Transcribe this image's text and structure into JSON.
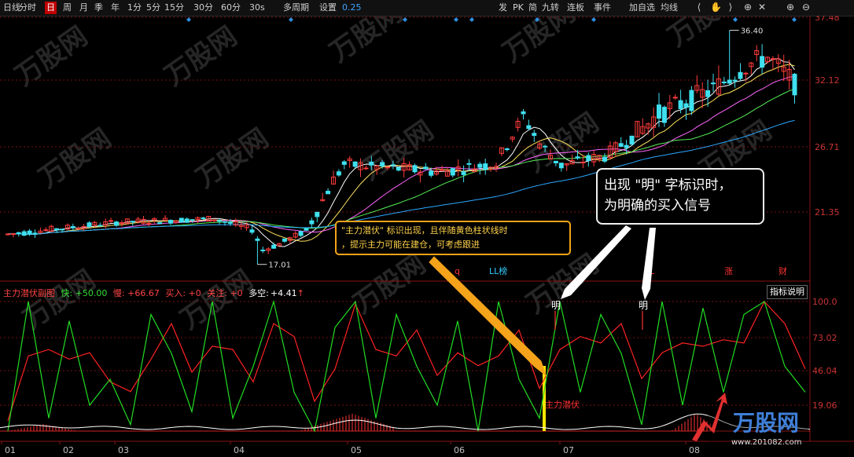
{
  "toolbar": {
    "left_buttons": [
      "日线",
      "分时",
      "日",
      "周",
      "月",
      "季",
      "年",
      "1分",
      "5分",
      "15分",
      "30分",
      "60分",
      "30s",
      "多周期",
      "设置"
    ],
    "selected": "日",
    "period_value": "0.25",
    "right_buttons": [
      "发",
      "PK",
      "简",
      "九转",
      "连板",
      "事件",
      "加自选",
      "均线"
    ],
    "icons": [
      "back-icon",
      "hand-icon",
      "forward-icon",
      "zoom-in-icon",
      "crosshair-icon",
      "zoom-plus-icon",
      "collapse-icon"
    ]
  },
  "price_axis": {
    "labels": [
      "37.48",
      "32.12",
      "26.71",
      "21.35"
    ]
  },
  "indicator_axis": {
    "labels": [
      "100.0",
      "73.02",
      "46.04",
      "19.06"
    ]
  },
  "x_axis": {
    "labels": [
      "01",
      "02",
      "03",
      "04",
      "05",
      "06",
      "07",
      "08"
    ]
  },
  "markers": {
    "high": "36.40",
    "low": "17.01"
  },
  "event_flags": [
    {
      "text": "q",
      "color": "#ff3333"
    },
    {
      "text": "LL榜",
      "color": "#33ccff"
    },
    {
      "text": "L",
      "color": "#ff3333"
    },
    {
      "text": "涨",
      "color": "#ff3333"
    },
    {
      "text": "财",
      "color": "#ff3333"
    }
  ],
  "indicator": {
    "name": "主力潜伏副图",
    "fast_label": "快: +50.00",
    "slow_label": "慢: +66.67",
    "buy_label": "买入: +0",
    "watch_label": "关注: +0",
    "longshort_label": "多空:",
    "longshort_value": "+4.41",
    "arrow": "↑",
    "help_button": "指标说明",
    "ming_label": "明",
    "latent_label": "主力潜伏"
  },
  "callouts": {
    "yellow_line1": "\"主力潜伏\" 标识出现，且伴随黄色柱状线时",
    "yellow_line2": "，提示主力可能在建仓，可考虑跟进",
    "white_line1": "出现 \"明\" 字标识时，",
    "white_line2": "为明确的买入信号"
  },
  "watermark": {
    "brand": "万股网",
    "url": "www.201082.com"
  },
  "colors": {
    "up": "#ff3b3b",
    "down": "#3fe0f0",
    "fast": "#22dd22",
    "slow": "#ff2222",
    "ma5": "#ffffff",
    "ma10": "#ffe35a",
    "ma20": "#ff66ff",
    "ma30": "#55ee55",
    "ma60": "#2aa8ff"
  },
  "chart_data": {
    "type": "candlestick",
    "price_ylim": [
      17.01,
      37.48
    ],
    "high": 36.4,
    "low": 17.01,
    "indicator_ylim": [
      0,
      100
    ],
    "indicator_values": {
      "fast": 50.0,
      "slow": 66.67,
      "buy": 0,
      "watch": 0,
      "longshort": 4.41
    },
    "x_tick_labels": [
      "01",
      "02",
      "03",
      "04",
      "05",
      "06",
      "07",
      "08"
    ]
  }
}
